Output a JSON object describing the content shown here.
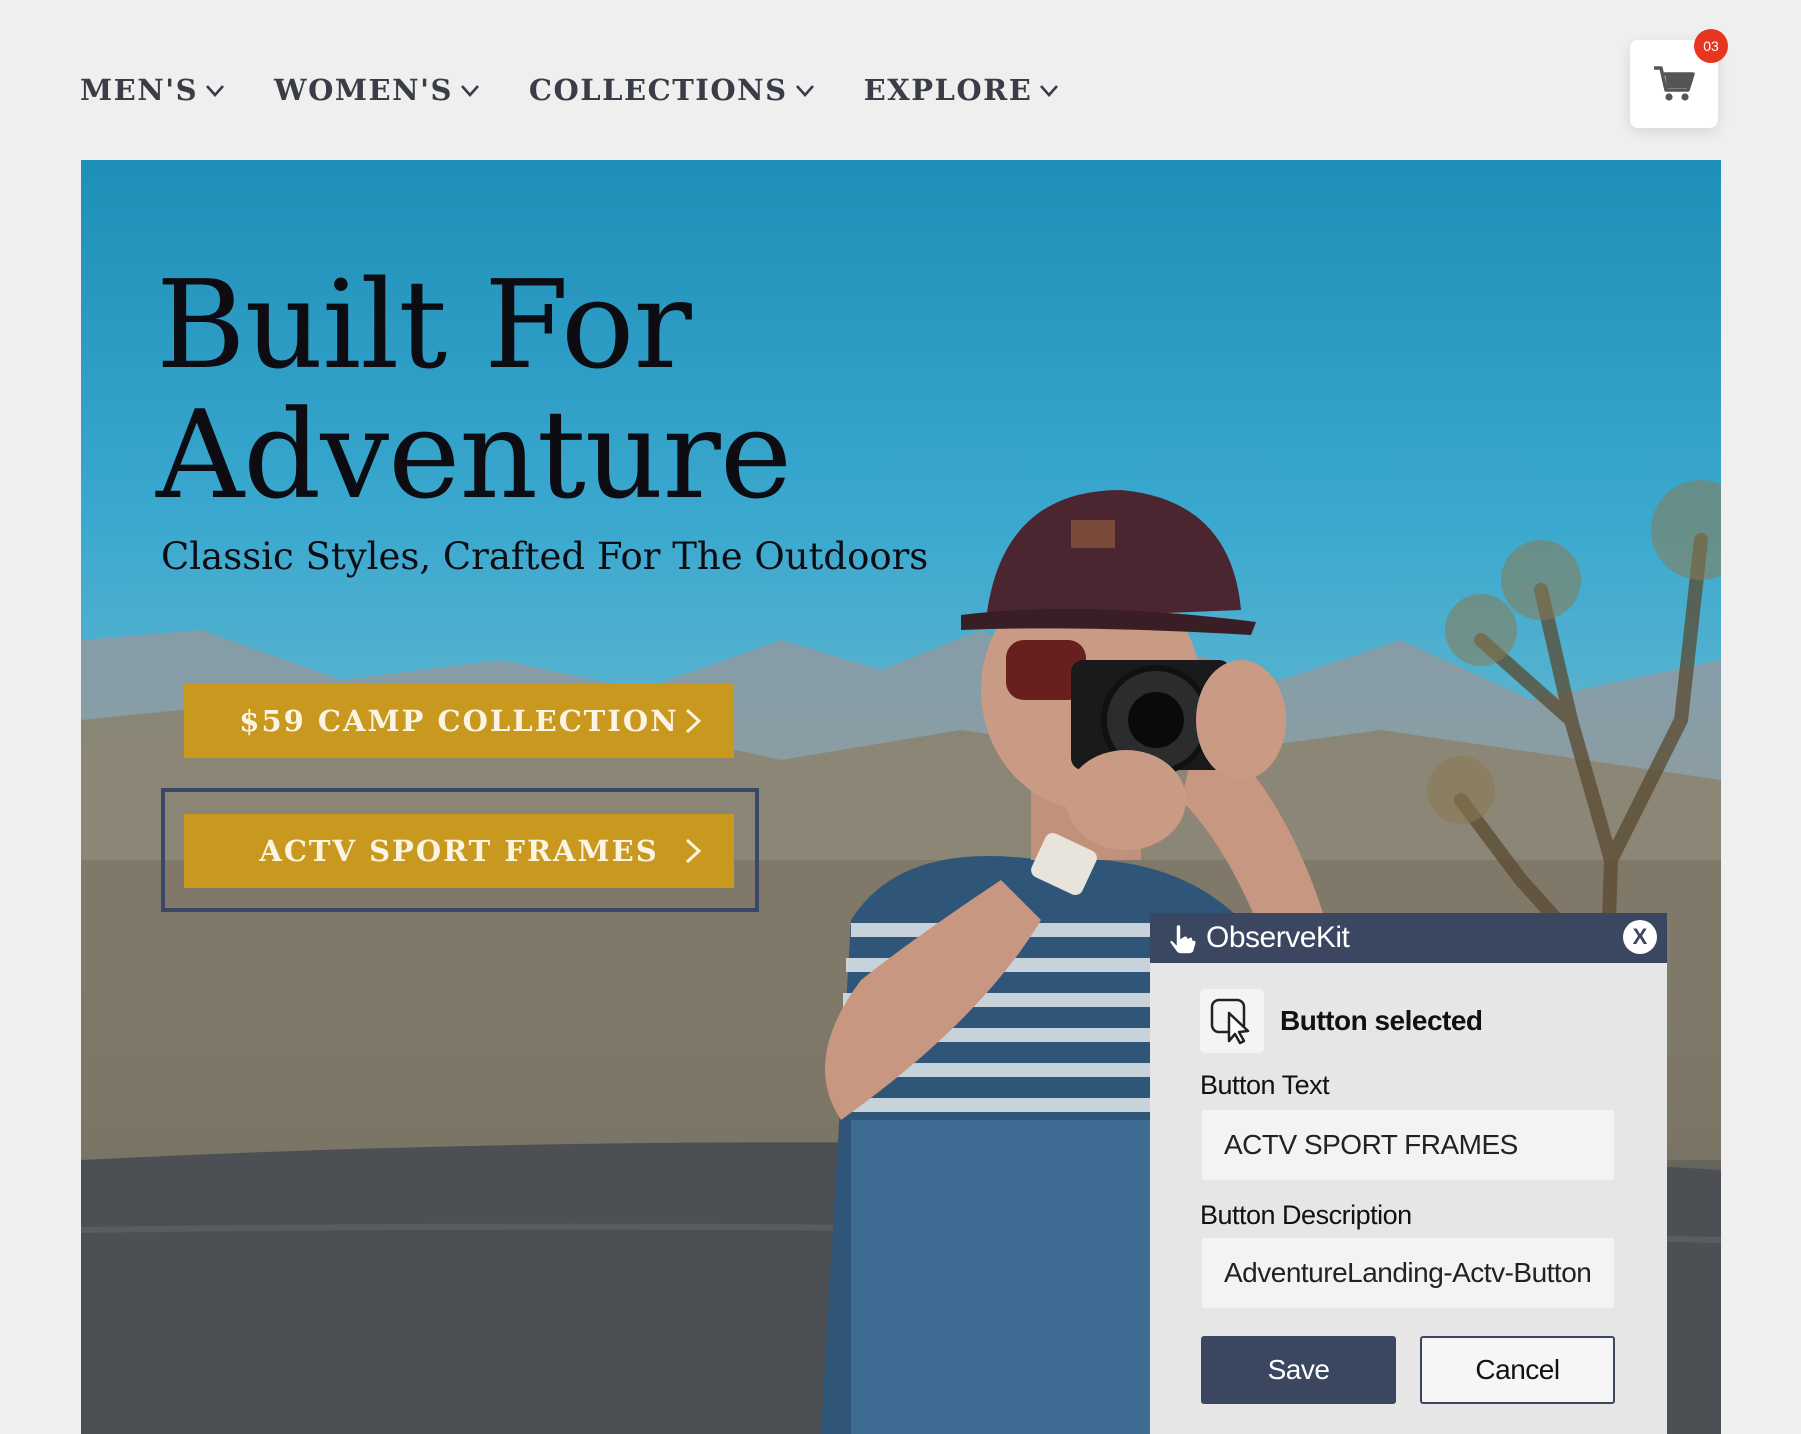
{
  "nav": {
    "items": [
      {
        "label": "MEN'S"
      },
      {
        "label": "WOMEN'S"
      },
      {
        "label": "COLLECTIONS"
      },
      {
        "label": "EXPLORE"
      }
    ]
  },
  "cart": {
    "icon": "cart-icon",
    "count": "03",
    "badge_color": "#e8351f"
  },
  "hero": {
    "title": "Built For\nAdventure",
    "subtitle": "Classic Styles, Crafted For The Outdoors",
    "cta_primary": "$59 CAMP COLLECTION",
    "cta_secondary": "ACTV SPORT FRAMES",
    "cta_color": "#c9991f",
    "selection_border_color": "#3b4766"
  },
  "observekit": {
    "title": "ObserveKit",
    "close_label": "X",
    "selected_text": "Button selected",
    "button_text_label": "Button Text",
    "button_text_value": "ACTV SPORT FRAMES",
    "button_desc_label": "Button Description",
    "button_desc_value": "AdventureLanding-Actv-Button",
    "save_label": "Save",
    "cancel_label": "Cancel",
    "header_color": "#3b4660"
  }
}
